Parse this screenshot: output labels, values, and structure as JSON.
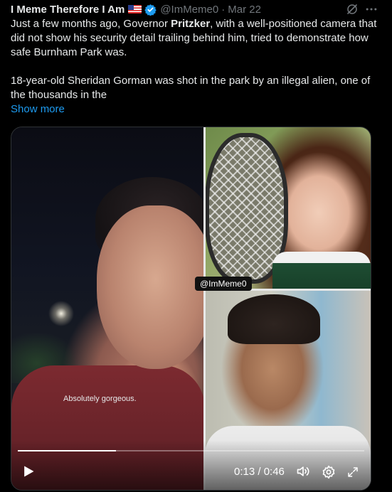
{
  "author": {
    "name": "I Meme Therefore I Am",
    "handle": "@ImMeme0",
    "separator": "·",
    "date": "Mar 22",
    "flag_icon": "us-flag-icon",
    "verified_icon": "verified-badge-icon"
  },
  "tweet": {
    "text_part1": "Just a few months ago, Governor ",
    "text_bold": "Pritzker",
    "text_part2": ", with a well-positioned camera that did not show his security detail trailing behind him, tried to demonstrate how safe Burnham Park was.",
    "paragraph2": "18-year-old Sheridan Gorman was shot in the park by an illegal alien, one of the thousands in the",
    "show_more": "Show more"
  },
  "media": {
    "subtitle": "Absolutely gorgeous.",
    "watermark": "@ImMeme0",
    "time": "0:13 / 0:46",
    "progress": 0.283
  },
  "icons": {
    "grok": "grok-icon",
    "more": "more-icon",
    "play": "play-icon",
    "volume": "volume-icon",
    "settings": "gear-icon",
    "fullscreen": "fullscreen-icon"
  },
  "colors": {
    "background": "#000000",
    "text": "#e7e9ea",
    "muted": "#71767b",
    "link": "#1d9bf0",
    "verified": "#1d9bf0"
  }
}
